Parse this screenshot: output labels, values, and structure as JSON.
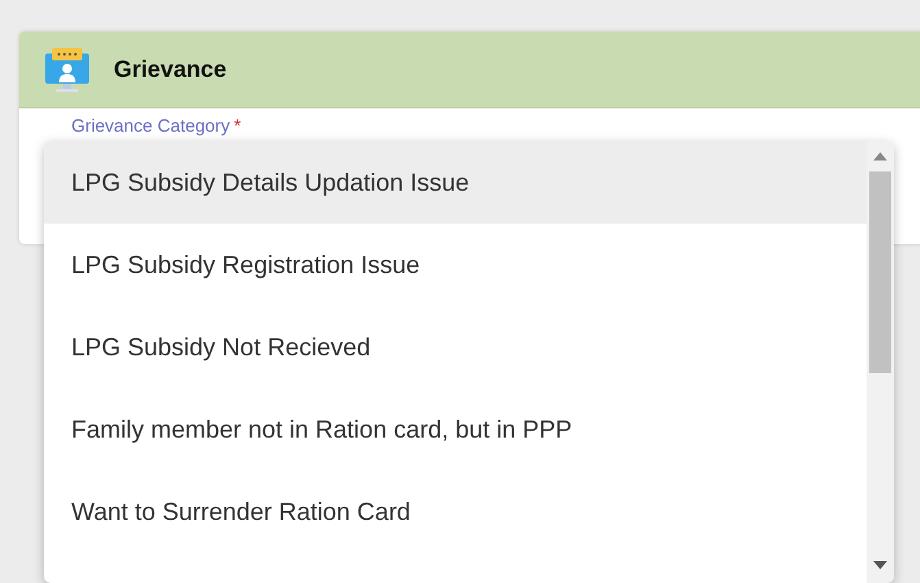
{
  "panel": {
    "title": "Grievance"
  },
  "field": {
    "label": "Grievance Category",
    "required_mark": "*"
  },
  "dropdown": {
    "options": [
      {
        "label": "LPG Subsidy Details Updation Issue",
        "selected": true
      },
      {
        "label": "LPG Subsidy Registration Issue",
        "selected": false
      },
      {
        "label": "LPG Subsidy Not Recieved",
        "selected": false
      },
      {
        "label": "Family member not in Ration card, but in PPP",
        "selected": false
      },
      {
        "label": "Want to Surrender Ration Card",
        "selected": false
      }
    ]
  }
}
